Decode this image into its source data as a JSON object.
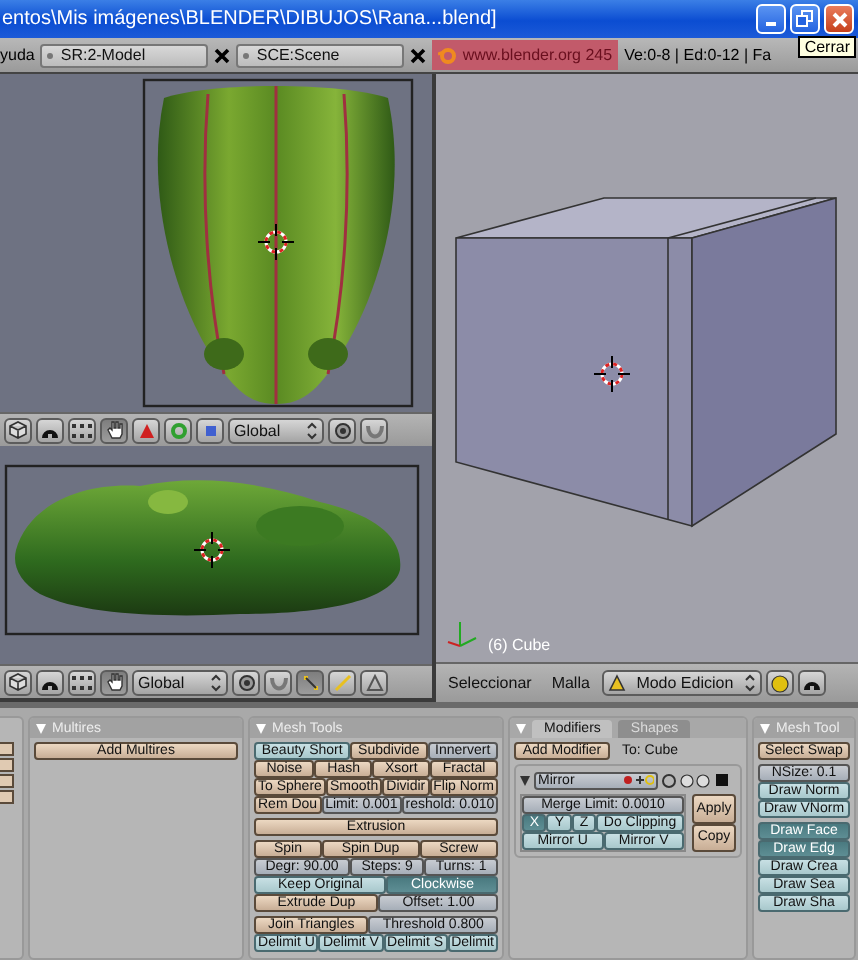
{
  "window": {
    "title": "entos\\Mis imágenes\\BLENDER\\DIBUJOS\\Rana...blend]",
    "tooltip": "Cerrar"
  },
  "header": {
    "menu": "yuda",
    "screen": "SR:2-Model",
    "scene": "SCE:Scene",
    "site": "www.blender.org 245",
    "stats": "Ve:0-8 | Ed:0-12 | Fa"
  },
  "left_views": [
    {
      "kind": "top",
      "orientation": "Global"
    },
    {
      "kind": "side",
      "orientation": "Global",
      "select_modes": [
        {
          "selected": true
        },
        {
          "selected": false
        },
        {
          "selected": false
        }
      ]
    }
  ],
  "right_view": {
    "object_label": "(6) Cube",
    "menus": [
      "Seleccionar",
      "Malla"
    ],
    "mode": "Modo Edicion"
  },
  "panels": [
    {
      "kind": "tools",
      "title": "Multires",
      "groups": [
        [
          [
            {
              "label": "Add Multires",
              "kind": "button"
            }
          ]
        ]
      ]
    },
    {
      "kind": "tools",
      "title": "Mesh Tools",
      "groups": [
        [
          [
            {
              "label": "Beauty Short",
              "kind": "toggle",
              "on": false
            },
            {
              "label": "Subdivide",
              "kind": "button"
            },
            {
              "label": "Innervert",
              "kind": "number"
            }
          ],
          [
            {
              "label": "Noise",
              "kind": "button"
            },
            {
              "label": "Hash",
              "kind": "button"
            },
            {
              "label": "Xsort",
              "kind": "button"
            },
            {
              "label": "Fractal",
              "kind": "button"
            }
          ],
          [
            {
              "label": "To Sphere",
              "kind": "button"
            },
            {
              "label": "Smooth",
              "kind": "button"
            },
            {
              "label": "Dividir",
              "kind": "button"
            },
            {
              "label": "Flip Norm",
              "kind": "button"
            }
          ],
          [
            {
              "label": "Rem Dou",
              "kind": "button"
            },
            {
              "label": "Limit: 0.001",
              "kind": "number"
            },
            {
              "label": "reshold: 0.010",
              "kind": "number"
            }
          ]
        ],
        [
          [
            {
              "label": "Extrusion",
              "kind": "button"
            }
          ]
        ],
        [
          [
            {
              "label": "Spin",
              "kind": "button"
            },
            {
              "label": "Spin Dup",
              "kind": "button"
            },
            {
              "label": "Screw",
              "kind": "button"
            }
          ],
          [
            {
              "label": "Degr: 90.00",
              "kind": "number"
            },
            {
              "label": "Steps: 9",
              "kind": "number"
            },
            {
              "label": "Turns: 1",
              "kind": "number"
            }
          ],
          [
            {
              "label": "Keep Original",
              "kind": "toggle",
              "on": false
            },
            {
              "label": "Clockwise",
              "kind": "toggle",
              "on": true
            }
          ],
          [
            {
              "label": "Extrude Dup",
              "kind": "button"
            },
            {
              "label": "Offset: 1.00",
              "kind": "number"
            }
          ]
        ],
        [
          [
            {
              "label": "Join Triangles",
              "kind": "button"
            },
            {
              "label": "Threshold 0.800",
              "kind": "number"
            }
          ],
          [
            {
              "label": "Delimit U",
              "kind": "toggle",
              "on": false
            },
            {
              "label": "Delimit V",
              "kind": "toggle",
              "on": false
            },
            {
              "label": "Delimit S",
              "kind": "toggle",
              "on": false
            },
            {
              "label": "Delimit",
              "kind": "toggle",
              "on": false
            }
          ]
        ]
      ]
    },
    {
      "kind": "modifiers",
      "tabs": [
        {
          "label": "Modifiers",
          "selected": true
        },
        {
          "label": "Shapes",
          "selected": false
        }
      ],
      "add_button": "Add Modifier",
      "target": "To: Cube",
      "modifier": {
        "name": "Mirror",
        "actions": [
          "Apply",
          "Copy"
        ],
        "merge_limit": "Merge Limit: 0.0010",
        "axes": [
          {
            "label": "X",
            "on": true
          },
          {
            "label": "Y",
            "on": false
          },
          {
            "label": "Z",
            "on": false
          },
          {
            "label": "Do Clipping",
            "on": false
          }
        ],
        "uv": [
          {
            "label": "Mirror U",
            "on": false
          },
          {
            "label": "Mirror V",
            "on": false
          }
        ]
      }
    },
    {
      "kind": "tools",
      "title": "Mesh Tool",
      "groups": [
        [
          [
            {
              "label": "Select Swap",
              "kind": "button"
            }
          ]
        ],
        [
          [
            {
              "label": "NSize: 0.1",
              "kind": "number"
            }
          ],
          [
            {
              "label": "Draw Norm",
              "kind": "toggle",
              "on": false
            }
          ],
          [
            {
              "label": "Draw VNorm",
              "kind": "toggle",
              "on": false
            }
          ]
        ],
        [
          [
            {
              "label": "Draw Face",
              "kind": "toggle",
              "on": true
            }
          ],
          [
            {
              "label": "Draw Edg",
              "kind": "toggle",
              "on": true
            }
          ],
          [
            {
              "label": "Draw Crea",
              "kind": "toggle",
              "on": false
            }
          ],
          [
            {
              "label": "Draw Sea",
              "kind": "toggle",
              "on": false
            }
          ],
          [
            {
              "label": "Draw Sha",
              "kind": "toggle",
              "on": false
            }
          ]
        ]
      ]
    }
  ]
}
